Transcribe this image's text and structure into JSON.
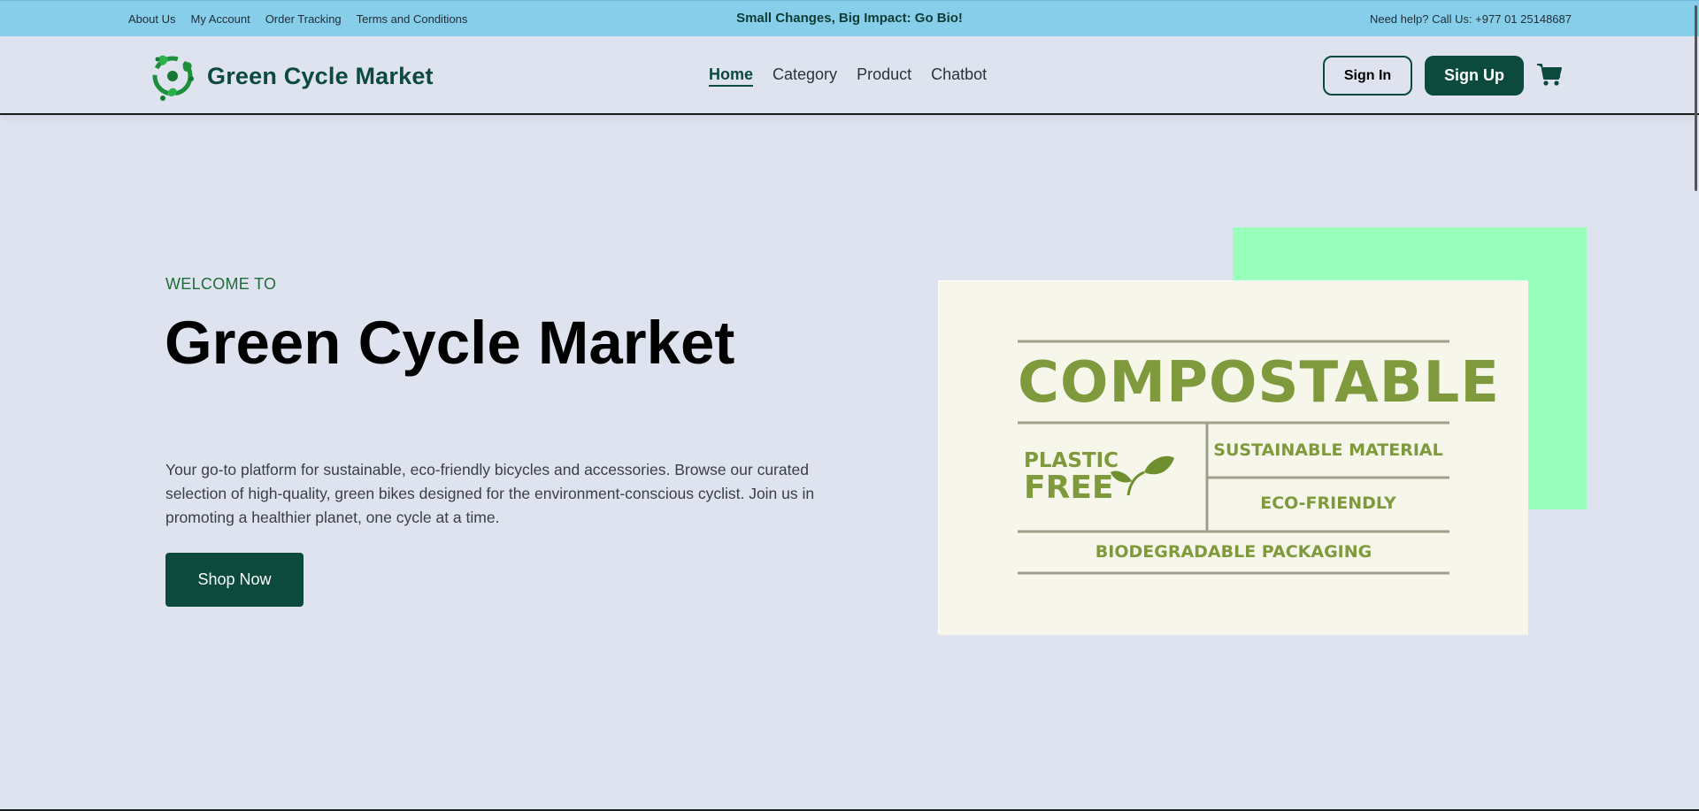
{
  "topbar": {
    "links": [
      "About Us",
      "My Account",
      "Order Tracking",
      "Terms and Conditions"
    ],
    "promo": "Small Changes, Big Impact: Go Bio!",
    "help": "Need help? Call Us: +977 01 25148687"
  },
  "header": {
    "brand": "Green Cycle Market",
    "nav": [
      {
        "label": "Home",
        "active": true
      },
      {
        "label": "Category",
        "active": false
      },
      {
        "label": "Product",
        "active": false
      },
      {
        "label": "Chatbot",
        "active": false
      }
    ],
    "signin_label": "Sign In",
    "signup_label": "Sign Up",
    "cart_icon": "shopping-cart-icon"
  },
  "hero": {
    "welcome": "WELCOME TO",
    "title": "Green Cycle Market",
    "description": "Your go-to platform for sustainable, eco-friendly bicycles and accessories. Browse our curated selection of high-quality, green bikes designed for the environment-conscious cyclist. Join us in promoting a healthier planet, one cycle at a time.",
    "cta_label": "Shop Now"
  },
  "hero_image": {
    "compostable": "COMPOSTABLE",
    "plastic": "PLASTIC",
    "free": "FREE",
    "sustainable": "SUSTAINABLE MATERIAL",
    "eco": "ECO-FRIENDLY",
    "biodegradable": "BIODEGRADABLE PACKAGING"
  },
  "colors": {
    "topbar": "#87ceeb",
    "primary": "#0b4a3c",
    "background": "#dfe3ef",
    "accent_block": "#98ffbc",
    "label_green": "#7f9a3c"
  }
}
